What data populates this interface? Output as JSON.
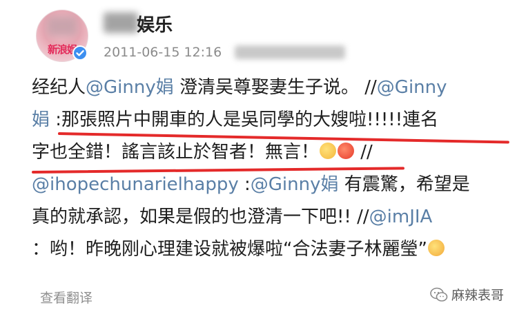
{
  "author": {
    "avatar_text": "新浪娱",
    "name": "娱乐",
    "timestamp": "2011-06-15 12:16"
  },
  "post": {
    "lines": [
      [
        "经纪人",
        "@Ginny娟",
        " 澄清吴尊娶妻生子说。 //",
        "@Ginny"
      ],
      [
        "娟",
        " :那張照片中開車的人是吳同學的大嫂啦!!!!!連名"
      ],
      [
        "字也全錯！謠言該止於智者！無言！",
        " //"
      ],
      [
        "@ihopechunarielhappy",
        " :",
        "@Ginny娟",
        " 有震驚，希望是"
      ],
      [
        "真的就承認，如果是假的也澄清一下吧!! //",
        "@imJIA"
      ],
      [
        "：哟！昨晚刚心理建设就被爆啦“合法妻子林麗瑩”"
      ]
    ]
  },
  "footer": {
    "translate_label": "查看翻译",
    "watermark_text": "麻辣表哥"
  },
  "colors": {
    "mention": "#5a7fa6",
    "underline": "#e42a2a",
    "muted": "#8f8f8f"
  }
}
